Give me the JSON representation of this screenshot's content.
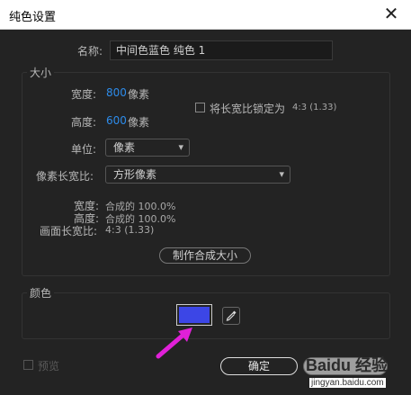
{
  "dialog": {
    "title": "纯色设置",
    "name_label": "名称:",
    "name_value": "中间色蓝色 纯色 1"
  },
  "size": {
    "group_title": "大小",
    "width_label": "宽度:",
    "width_value": "800",
    "width_unit": "像素",
    "height_label": "高度:",
    "height_value": "600",
    "height_unit": "像素",
    "lock_label": "将长宽比锁定为",
    "lock_ratio": "4:3 (1.33)",
    "unit_label": "单位:",
    "unit_value": "像素",
    "pixel_aspect_label": "像素长宽比:",
    "pixel_aspect_value": "方形像素",
    "info_width_label": "宽度:",
    "info_width_value": "合成的 100.0%",
    "info_height_label": "高度:",
    "info_height_value": "合成的 100.0%",
    "info_frame_label": "画面长宽比:",
    "info_frame_value": "4:3 (1.33)",
    "make_comp_size_button": "制作合成大小"
  },
  "color": {
    "group_title": "颜色",
    "swatch_hex": "#3c46e6"
  },
  "footer": {
    "preview_label": "预览",
    "ok_button": "确定"
  },
  "watermark": {
    "brand": "Baidu 经验",
    "url": "jingyan.baidu.com"
  },
  "colors": {
    "accent_blue": "#2d8ceb",
    "arrow_magenta": "#e020d8",
    "dialog_bg": "#232323"
  },
  "icons": {
    "close": "close-icon",
    "eyedropper": "eyedropper-icon",
    "dropdown": "chevron-down-icon",
    "annotation": "arrow-icon"
  }
}
